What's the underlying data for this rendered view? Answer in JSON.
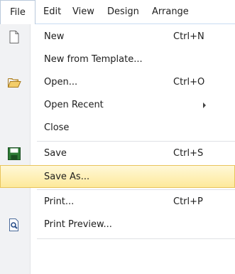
{
  "menubar": {
    "items": [
      "File",
      "Edit",
      "View",
      "Design",
      "Arrange"
    ]
  },
  "file_menu": {
    "items": [
      {
        "label": "New",
        "shortcut": "Ctrl+N",
        "icon": "new-document-icon"
      },
      {
        "label": "New from Template...",
        "shortcut": ""
      },
      {
        "label": "Open...",
        "shortcut": "Ctrl+O",
        "icon": "open-folder-icon"
      },
      {
        "label": "Open Recent",
        "shortcut": "",
        "submenu": true
      },
      {
        "label": "Close",
        "shortcut": ""
      },
      {
        "label": "Save",
        "shortcut": "Ctrl+S",
        "icon": "save-icon"
      },
      {
        "label": "Save As...",
        "shortcut": "",
        "highlighted": true
      },
      {
        "label": "Print...",
        "shortcut": "Ctrl+P"
      },
      {
        "label": "Print Preview...",
        "shortcut": "",
        "icon": "print-preview-icon"
      }
    ]
  },
  "colors": {
    "highlight_top": "#fff8d8",
    "highlight_bottom": "#fde99a",
    "highlight_border": "#e8c45c",
    "gutter": "#f1f2f4"
  }
}
